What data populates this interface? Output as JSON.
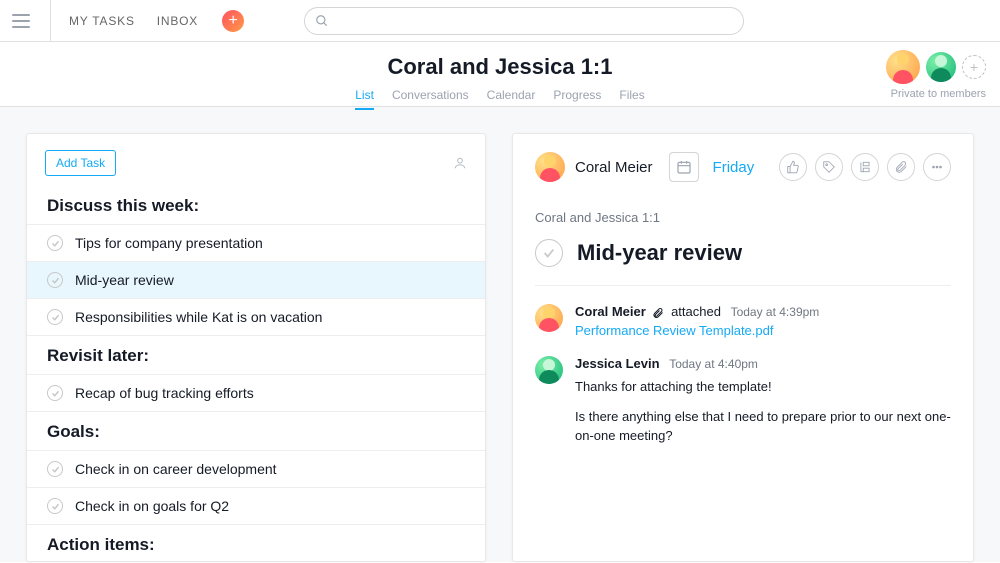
{
  "topnav": {
    "my_tasks": "MY TASKS",
    "inbox": "INBOX"
  },
  "header": {
    "title": "Coral and Jessica 1:1",
    "tabs": [
      "List",
      "Conversations",
      "Calendar",
      "Progress",
      "Files"
    ],
    "active_tab": "List",
    "privacy": "Private to members"
  },
  "left": {
    "add_task": "Add Task",
    "sections": [
      {
        "title": "Discuss this week:",
        "tasks": [
          {
            "label": "Tips for company presentation",
            "selected": false
          },
          {
            "label": "Mid-year review",
            "selected": true
          },
          {
            "label": "Responsibilities while Kat is on vacation",
            "selected": false
          }
        ]
      },
      {
        "title": "Revisit later:",
        "tasks": [
          {
            "label": "Recap of bug tracking efforts",
            "selected": false
          }
        ]
      },
      {
        "title": "Goals:",
        "tasks": [
          {
            "label": "Check in on career development",
            "selected": false
          },
          {
            "label": "Check in on goals for Q2",
            "selected": false
          }
        ]
      },
      {
        "title": "Action items:",
        "tasks": []
      }
    ]
  },
  "detail": {
    "assignee": "Coral Meier",
    "due": "Friday",
    "breadcrumb": "Coral and Jessica 1:1",
    "title": "Mid-year review",
    "activity": [
      {
        "who": "Coral Meier",
        "avatar": "coral",
        "action": "attached",
        "time": "Today at 4:39pm",
        "file": "Performance Review Template.pdf"
      },
      {
        "who": "Jessica Levin",
        "avatar": "jess",
        "time": "Today at 4:40pm",
        "comment": [
          "Thanks for attaching the template!",
          "Is there anything else that I need to prepare prior to our next one-on-one meeting?"
        ]
      }
    ]
  }
}
